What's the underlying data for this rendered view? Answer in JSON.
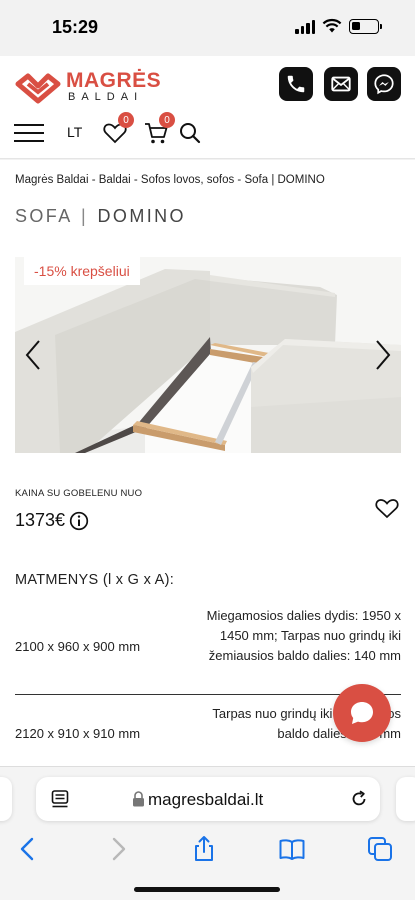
{
  "status_bar": {
    "time": "15:29"
  },
  "header": {
    "logo": {
      "word1": "MAGRĖS",
      "word2": "BALDAI"
    },
    "contact_icons": [
      "phone-icon",
      "mail-icon",
      "messenger-icon"
    ],
    "language": "LT",
    "wishlist_count": "0",
    "cart_count": "0"
  },
  "breadcrumb": "Magrės Baldai - Baldai - Sofos lovos, sofos - Sofa | DOMINO",
  "product": {
    "title_category": "SOFA",
    "title_separator": "|",
    "title_name": "DOMINO",
    "promo": "-15% krepšeliui",
    "price_label": "KAINA SU GOBELENU NUO",
    "price": "1373€"
  },
  "dimensions": {
    "title": "MATMENYS (l x G x A):",
    "rows": [
      {
        "size": "2100 x 960 x 900 mm",
        "note": "Miegamosios dalies dydis: 1950 x 1450 mm; Tarpas nuo grindų iki žemiausios baldo dalies: 140 mm"
      },
      {
        "size": "2120 x 910 x 910 mm",
        "note": "Tarpas nuo grindų iki žemiausios baldo dalies: 140 mm"
      }
    ]
  },
  "browser": {
    "url": "magresbaldai.lt"
  },
  "colors": {
    "accent": "#d94f43",
    "dark": "#111111"
  }
}
